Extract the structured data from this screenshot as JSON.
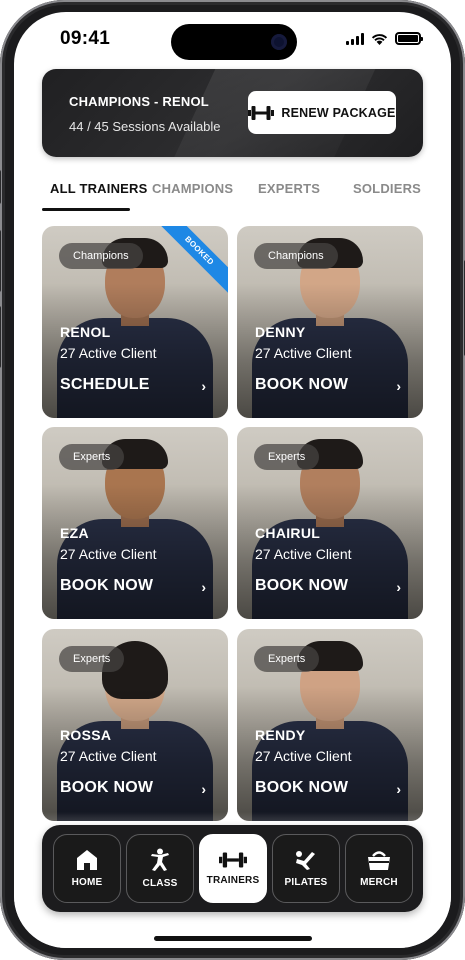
{
  "status_bar": {
    "time": "09:41",
    "signal_icon": "cellular-signal-icon",
    "wifi_icon": "wifi-icon",
    "battery_icon": "battery-icon"
  },
  "package": {
    "title": "CHAMPIONS - RENOL",
    "sessions": "44 / 45 Sessions Available",
    "renew_label": "RENEW PACKAGE",
    "renew_icon": "dumbbell-icon"
  },
  "tabs": [
    {
      "label": "ALL TRAINERS",
      "active": true
    },
    {
      "label": "CHAMPIONS",
      "active": false
    },
    {
      "label": "EXPERTS",
      "active": false
    },
    {
      "label": "SOLDIERS",
      "active": false
    }
  ],
  "trainers": [
    {
      "tier": "Champions",
      "name": "RENOL",
      "clients": "27 Active Client",
      "action": "SCHEDULE",
      "booked_label": "BOOKED",
      "chevron": "›"
    },
    {
      "tier": "Champions",
      "name": "DENNY",
      "clients": "27 Active Client",
      "action": "BOOK NOW",
      "chevron": "›"
    },
    {
      "tier": "Experts",
      "name": "EZA",
      "clients": "27 Active Client",
      "action": "BOOK NOW",
      "chevron": "›"
    },
    {
      "tier": "Experts",
      "name": "CHAIRUL",
      "clients": "27 Active Client",
      "action": "BOOK NOW",
      "chevron": "›"
    },
    {
      "tier": "Experts",
      "name": "ROSSA",
      "clients": "27 Active Client",
      "action": "BOOK NOW",
      "chevron": "›"
    },
    {
      "tier": "Experts",
      "name": "RENDY",
      "clients": "27 Active Client",
      "action": "BOOK NOW",
      "chevron": "›"
    }
  ],
  "nav": [
    {
      "label": "HOME",
      "icon": "home-icon",
      "active": false
    },
    {
      "label": "CLASS",
      "icon": "person-exercise-icon",
      "active": false
    },
    {
      "label": "TRAINERS",
      "icon": "dumbbell-icon",
      "active": true
    },
    {
      "label": "PILATES",
      "icon": "pilates-icon",
      "active": false
    },
    {
      "label": "MERCH",
      "icon": "bag-icon",
      "active": false
    }
  ],
  "colors": {
    "accent_blue": "#1e88e5",
    "dark": "#1c1c1e",
    "card_overlay": "#464442"
  }
}
